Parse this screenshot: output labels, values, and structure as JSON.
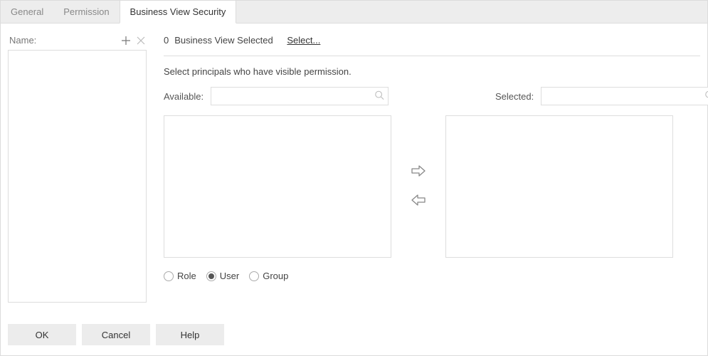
{
  "tabs": {
    "general": "General",
    "permission": "Permission",
    "bvs": "Business View Security",
    "active": "bvs"
  },
  "left": {
    "label": "Name:"
  },
  "top": {
    "count": "0",
    "suffix": "Business View Selected",
    "select_link": "Select..."
  },
  "instruction": "Select principals who have visible permission.",
  "available": {
    "label": "Available:"
  },
  "selected": {
    "label": "Selected:"
  },
  "principal_types": {
    "role": "Role",
    "user": "User",
    "group": "Group",
    "checked": "user"
  },
  "buttons": {
    "ok": "OK",
    "cancel": "Cancel",
    "help": "Help"
  }
}
